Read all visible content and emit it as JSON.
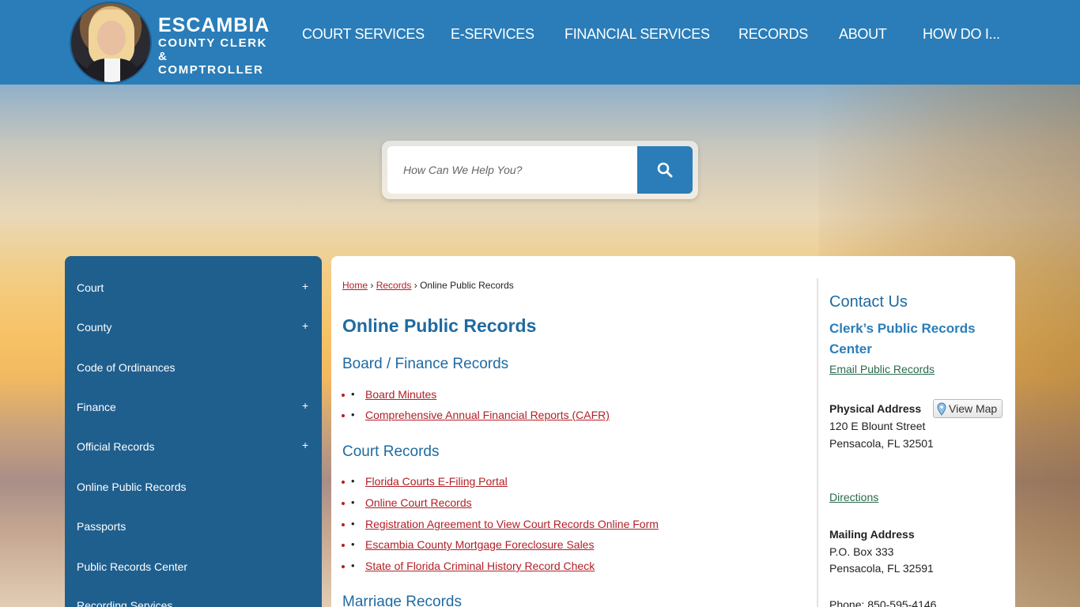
{
  "logo": {
    "line1": "ESCAMBIA",
    "line2": "COUNTY CLERK",
    "line3": "& COMPTROLLER"
  },
  "nav": [
    {
      "label": "COURT SERVICES"
    },
    {
      "label": "E-SERVICES"
    },
    {
      "label": "FINANCIAL SERVICES"
    },
    {
      "label": "RECORDS"
    },
    {
      "label": "ABOUT"
    },
    {
      "label": "HOW DO I..."
    }
  ],
  "search": {
    "placeholder": "How Can We Help You?"
  },
  "sidebar": {
    "items": [
      {
        "label": "Court",
        "expand": "+"
      },
      {
        "label": "County",
        "expand": "+"
      },
      {
        "label": "Code of Ordinances",
        "expand": ""
      },
      {
        "label": "Finance",
        "expand": "+"
      },
      {
        "label": "Official Records",
        "expand": "+"
      },
      {
        "label": "Online Public Records",
        "expand": ""
      },
      {
        "label": "Passports",
        "expand": ""
      },
      {
        "label": "Public Records Center",
        "expand": ""
      },
      {
        "label": "Recording Services",
        "expand": ""
      }
    ]
  },
  "breadcrumb": {
    "home": "Home",
    "records": "Records",
    "current": "Online Public Records",
    "sep": "›"
  },
  "main": {
    "title": "Online Public Records",
    "sections": [
      {
        "heading": "Board / Finance Records",
        "links": [
          "Board Minutes",
          "Comprehensive Annual Financial Reports (CAFR)"
        ]
      },
      {
        "heading": "Court Records",
        "links": [
          "Florida Courts E-Filing Portal",
          "Online Court Records",
          "Registration Agreement to View Court Records Online Form",
          "Escambia County Mortgage Foreclosure Sales",
          "State of Florida Criminal History Record Check"
        ]
      },
      {
        "heading": "Marriage Records",
        "links": []
      }
    ]
  },
  "contact": {
    "title": "Contact Us",
    "subtitle": "Clerk’s Public Records Center",
    "email_link": "Email Public Records",
    "physical_label": "Physical Address",
    "view_map": "View Map",
    "physical_line1": "120 E Blount Street",
    "physical_line2": "Pensacola, FL 32501",
    "directions": "Directions",
    "mailing_label": "Mailing Address",
    "mailing_line1": "P.O. Box 333",
    "mailing_line2": "Pensacola, FL 32591",
    "phone": "Phone: 850-595-4146"
  },
  "colors": {
    "header": "#2a7db8",
    "sidebar": "#1f5f8e",
    "link": "#b12027",
    "heading": "#1f6aa1"
  }
}
